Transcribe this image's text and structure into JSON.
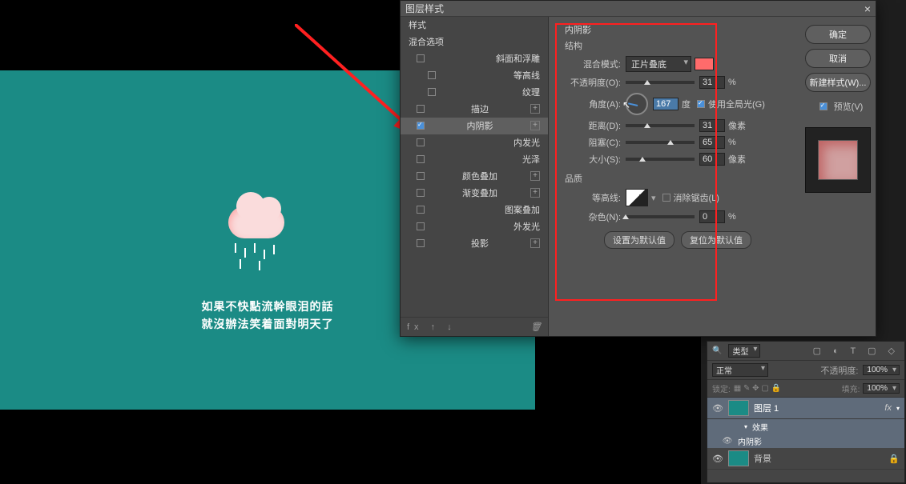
{
  "dialog_title": "图层样式",
  "canvas_text": {
    "line1": "如果不快點流幹眼泪的話",
    "line2": "就沒辦法笑着面對明天了"
  },
  "styles_list": {
    "header_styles": "样式",
    "header_blend": "混合选项",
    "bevel": "斜面和浮雕",
    "contour_item": "等高线",
    "texture": "纹理",
    "stroke": "描边",
    "inner_shadow": "内阴影",
    "inner_glow": "内发光",
    "satin": "光泽",
    "color_overlay": "颜色叠加",
    "gradient_overlay": "渐变叠加",
    "pattern_overlay": "图案叠加",
    "outer_glow": "外发光",
    "drop_shadow": "投影",
    "fx_label": "fx"
  },
  "settings": {
    "section": "内阴影",
    "structure": "结构",
    "blend_mode_label": "混合模式:",
    "blend_mode_value": "正片叠底",
    "opacity_label": "不透明度(O):",
    "opacity_value": "31",
    "percent": "%",
    "angle_label": "角度(A):",
    "angle_value": "167",
    "angle_unit": "度",
    "global_light": "使用全局光(G)",
    "distance_label": "距离(D):",
    "distance_value": "31",
    "px": "像素",
    "choke_label": "阻塞(C):",
    "choke_value": "65",
    "size_label": "大小(S):",
    "size_value": "60",
    "quality": "品质",
    "contour_label": "等高线:",
    "antialias": "消除锯齿(L)",
    "noise_label": "杂色(N):",
    "noise_value": "0",
    "set_default": "设置为默认值",
    "reset_default": "复位为默认值"
  },
  "buttons": {
    "ok": "确定",
    "cancel": "取消",
    "new_style": "新建样式(W)...",
    "preview": "预览(V)"
  },
  "layers_panel": {
    "filter": "类型",
    "mode": "正常",
    "opacity_label": "不透明度:",
    "opacity_val": "100%",
    "lock_label": "锁定:",
    "fill_label": "填充:",
    "fill_val": "100%",
    "layer1": "图层 1",
    "fx": "fx",
    "effects": "效果",
    "inner_shadow": "内阴影",
    "background": "背景"
  }
}
